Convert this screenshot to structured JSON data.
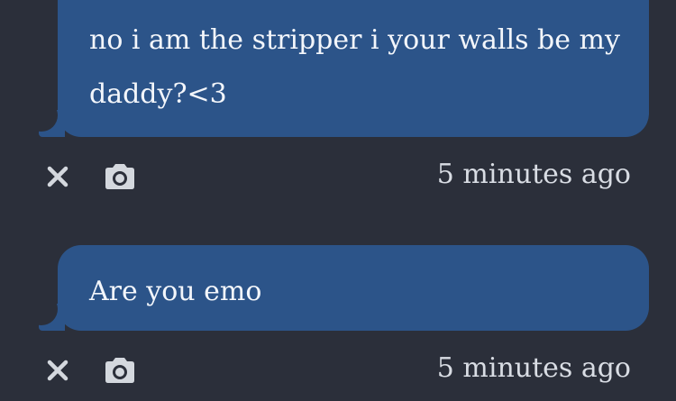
{
  "messages": [
    {
      "text": "no i am the stripper i your walls be my daddy?<3",
      "timestamp": "5 minutes ago",
      "icons": {
        "dismiss": "close-icon",
        "capture": "camera-icon"
      }
    },
    {
      "text": "Are you emo",
      "timestamp": "5 minutes ago",
      "icons": {
        "dismiss": "close-icon",
        "capture": "camera-icon"
      }
    }
  ],
  "colors": {
    "background": "#2b2f3a",
    "bubble": "#2c5489",
    "bubble_text": "#f3f6fb",
    "meta_text": "#d9dde4",
    "icon": "#d4d8de"
  }
}
